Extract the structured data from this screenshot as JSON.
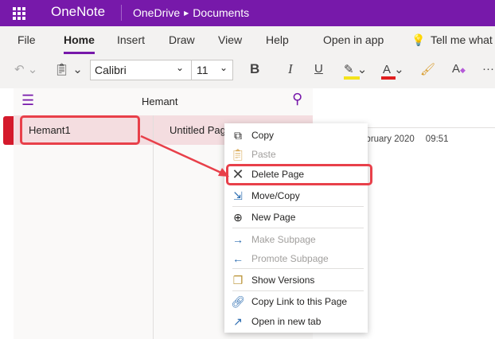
{
  "header": {
    "app_name": "OneNote",
    "breadcrumb": [
      "OneDrive",
      "Documents"
    ]
  },
  "ribbon": {
    "tabs": [
      "File",
      "Home",
      "Insert",
      "Draw",
      "View",
      "Help"
    ],
    "active_tab": "Home",
    "open_in_app": "Open in app",
    "tell_me": "Tell me what",
    "font": "Calibri",
    "size": "11",
    "bold": "B",
    "italic": "I",
    "underline": "U",
    "font_color_glyph": "A",
    "style_glyph": "A",
    "more": "···"
  },
  "colors": {
    "brand": "#7719aa",
    "highlight": "#f4e31c",
    "font_color": "#e01f1f",
    "annotation": "#e8404a"
  },
  "notebook": {
    "name": "Hemant",
    "sections": [
      "Hemant1"
    ],
    "pages": [
      "Untitled Page"
    ]
  },
  "page": {
    "date": "February 2020",
    "time": "09:51"
  },
  "context_menu": [
    {
      "label": "Copy",
      "icon": "copy-icon",
      "disabled": false
    },
    {
      "label": "Paste",
      "icon": "paste-icon",
      "disabled": true
    },
    {
      "label": "Delete Page",
      "icon": "delete-icon",
      "disabled": false
    },
    {
      "label": "Move/Copy",
      "icon": "move-icon",
      "disabled": false
    },
    {
      "label": "New Page",
      "icon": "plus-circle-icon",
      "disabled": false
    },
    {
      "label": "Make Subpage",
      "icon": "arrow-right-icon",
      "disabled": true
    },
    {
      "label": "Promote Subpage",
      "icon": "arrow-left-icon",
      "disabled": true
    },
    {
      "label": "Show Versions",
      "icon": "versions-icon",
      "disabled": false
    },
    {
      "label": "Copy Link to this Page",
      "icon": "link-icon",
      "disabled": false
    },
    {
      "label": "Open in new tab",
      "icon": "open-new-tab-icon",
      "disabled": false
    }
  ]
}
